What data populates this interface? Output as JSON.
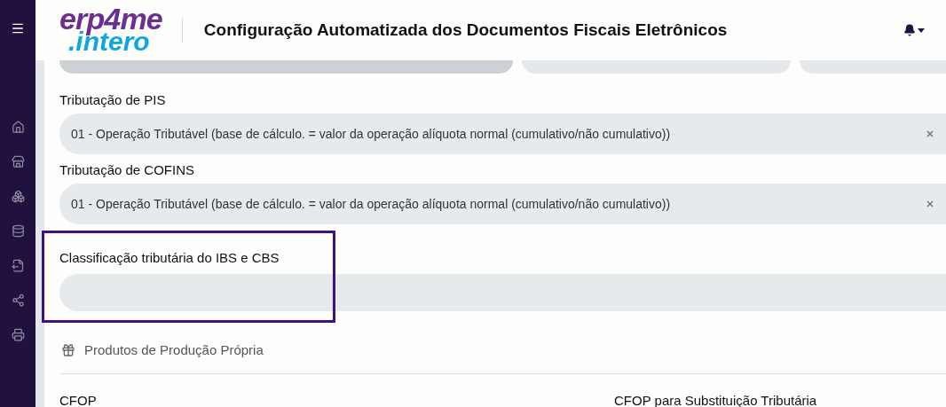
{
  "header": {
    "logo_top": "erp4me",
    "logo_bottom": ".intero",
    "title": "Configuração Automatizada dos Documentos Fiscais Eletrônicos"
  },
  "fields": [
    {
      "label": "Tributação de PIS",
      "value": "01 - Operação Tributável (base de cálculo. = valor da operação alíquota normal (cumulativo/não cumulativo))",
      "clearable": true,
      "highlighted": false
    },
    {
      "label": "Tributação de COFINS",
      "value": "01 - Operação Tributável (base de cálculo. = valor da operação alíquota normal (cumulativo/não cumulativo))",
      "clearable": true,
      "highlighted": false
    },
    {
      "label": "Classificação tributária do IBS e CBS",
      "clearable": false,
      "highlighted": true
    }
  ],
  "section": {
    "title": "Produtos de Produção Própria"
  },
  "columns": [
    "CFOP",
    "CFOP para Substituição Tributária"
  ]
}
